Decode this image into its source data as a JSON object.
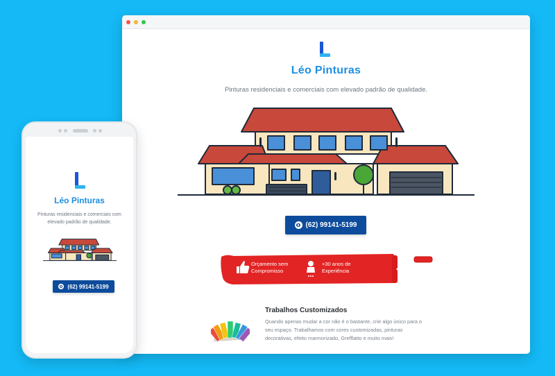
{
  "brand": {
    "name": "Léo Pinturas",
    "tagline": "Pinturas residenciais e comerciais com elevado padrão de qualidade.",
    "primary_color": "#1d8fe0",
    "logo_color": "#1a56d6"
  },
  "cta": {
    "phone": "(62) 99141-5199",
    "icon": "whatsapp-icon",
    "button_color": "#0d4c9c"
  },
  "banner": {
    "color": "#e32424",
    "items": [
      {
        "icon": "thumbs-up-icon",
        "line1": "Orçamento sem",
        "line2": "Compromisso"
      },
      {
        "icon": "painter-icon",
        "line1": "+30 anos de",
        "line2": "Experiência"
      }
    ]
  },
  "feature": {
    "title": "Trabalhos Customizados",
    "description": "Quando apenas mudar a cor não é o bastante, crie algo único para o seu espaço. Trabalhamos com cores customizadas, pinturas decorativas, efeito marmorizado, Grefflatto e muito mais!",
    "icon": "color-swatch-icon"
  },
  "background_color": "#14b9f5"
}
